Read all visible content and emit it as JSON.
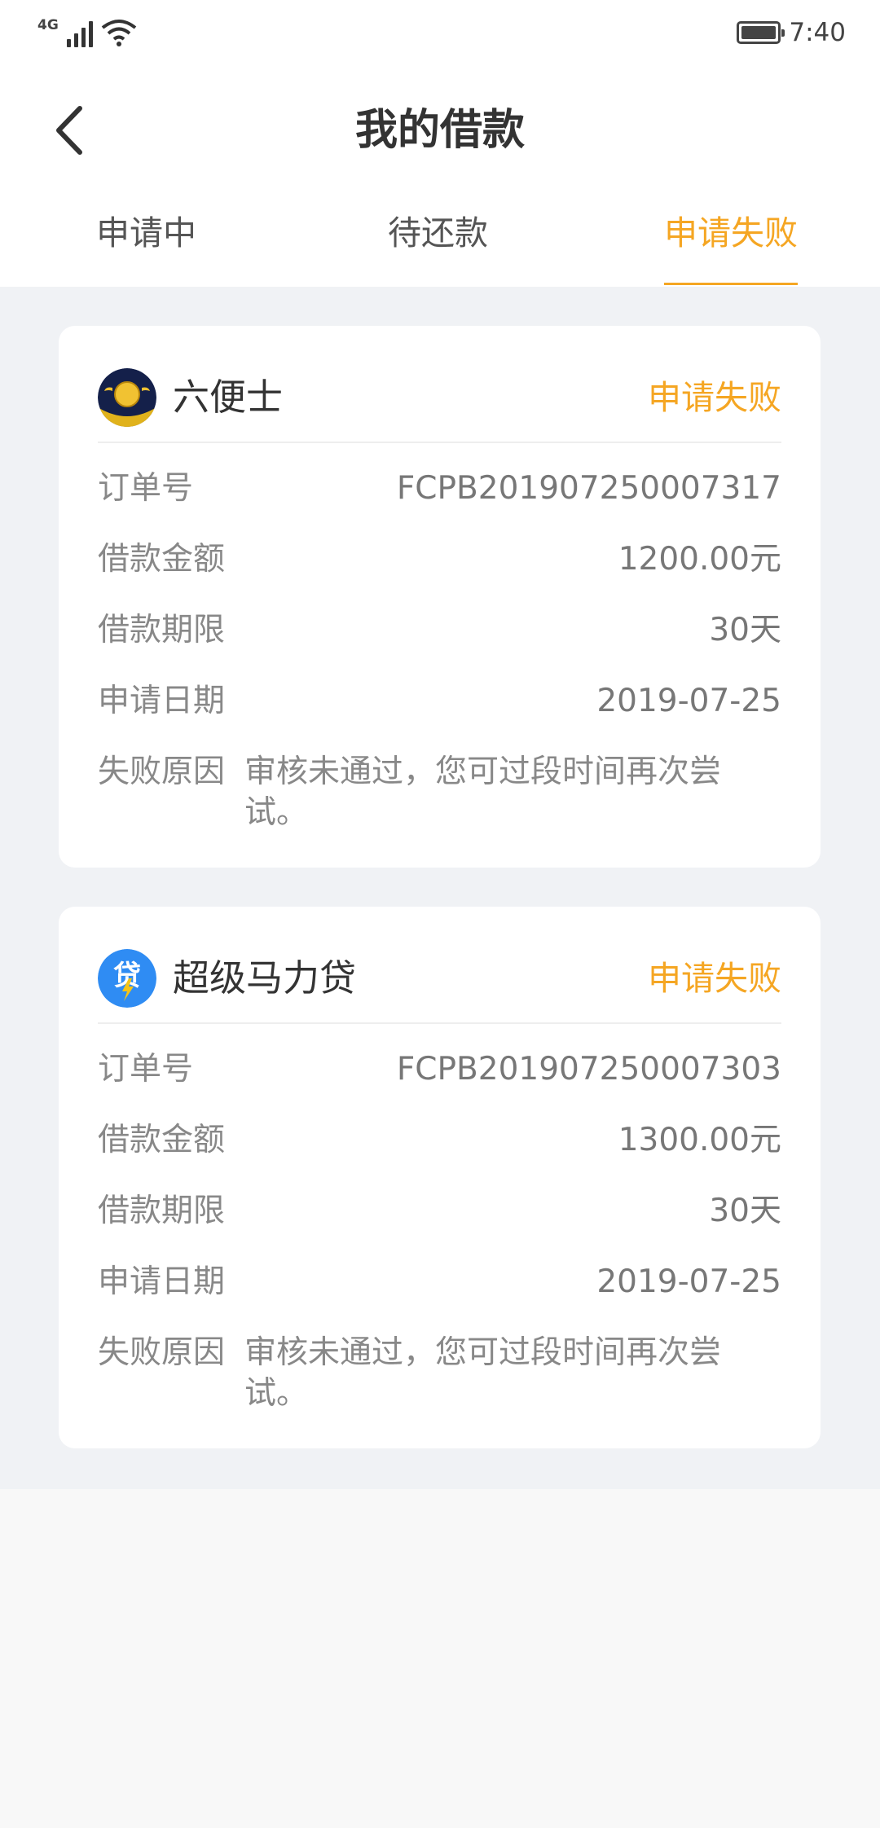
{
  "status_bar": {
    "network": "4G",
    "time": "7:40",
    "icons": [
      "signal-icon",
      "wifi-icon",
      "battery-icon"
    ]
  },
  "header": {
    "back_icon": "chevron-left-icon",
    "title": "我的借款"
  },
  "tabs": [
    {
      "label": "申请中",
      "active": false
    },
    {
      "label": "待还款",
      "active": false
    },
    {
      "label": "申请失败",
      "active": true
    }
  ],
  "colors": {
    "accent": "#f5a623",
    "page_bg": "#f0f2f5",
    "card_bg": "#ffffff"
  },
  "orders": [
    {
      "product": "六便士",
      "logo_icon": "coin-logo-icon",
      "status": "申请失败",
      "fields": [
        {
          "label": "订单号",
          "value": "FCPB201907250007317"
        },
        {
          "label": "借款金额",
          "value": "1200.00元"
        },
        {
          "label": "借款期限",
          "value": "30天"
        },
        {
          "label": "申请日期",
          "value": "2019-07-25"
        }
      ],
      "reason_label": "失败原因",
      "reason": "审核未通过，您可过段时间再次尝试。"
    },
    {
      "product": "超级马力贷",
      "logo_icon": "lightning-logo-icon",
      "status": "申请失败",
      "fields": [
        {
          "label": "订单号",
          "value": "FCPB201907250007303"
        },
        {
          "label": "借款金额",
          "value": "1300.00元"
        },
        {
          "label": "借款期限",
          "value": "30天"
        },
        {
          "label": "申请日期",
          "value": "2019-07-25"
        }
      ],
      "reason_label": "失败原因",
      "reason": "审核未通过，您可过段时间再次尝试。"
    }
  ]
}
